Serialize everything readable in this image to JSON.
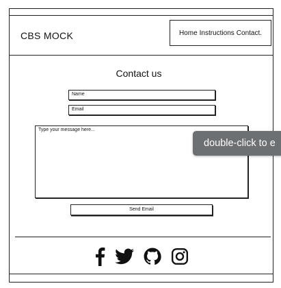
{
  "header": {
    "brand": "CBS MOCK",
    "nav": [
      "Home",
      "Instructions",
      "Contact."
    ]
  },
  "contact": {
    "title": "Contact us",
    "name_placeholder": "Name",
    "email_placeholder": "Email",
    "message_placeholder": "Type your message here...",
    "send_label": "Send Email"
  },
  "tooltip": {
    "text": "double-click to e"
  },
  "footer": {
    "social_icons": [
      "facebook-icon",
      "twitter-icon",
      "github-icon",
      "instagram-icon"
    ]
  }
}
